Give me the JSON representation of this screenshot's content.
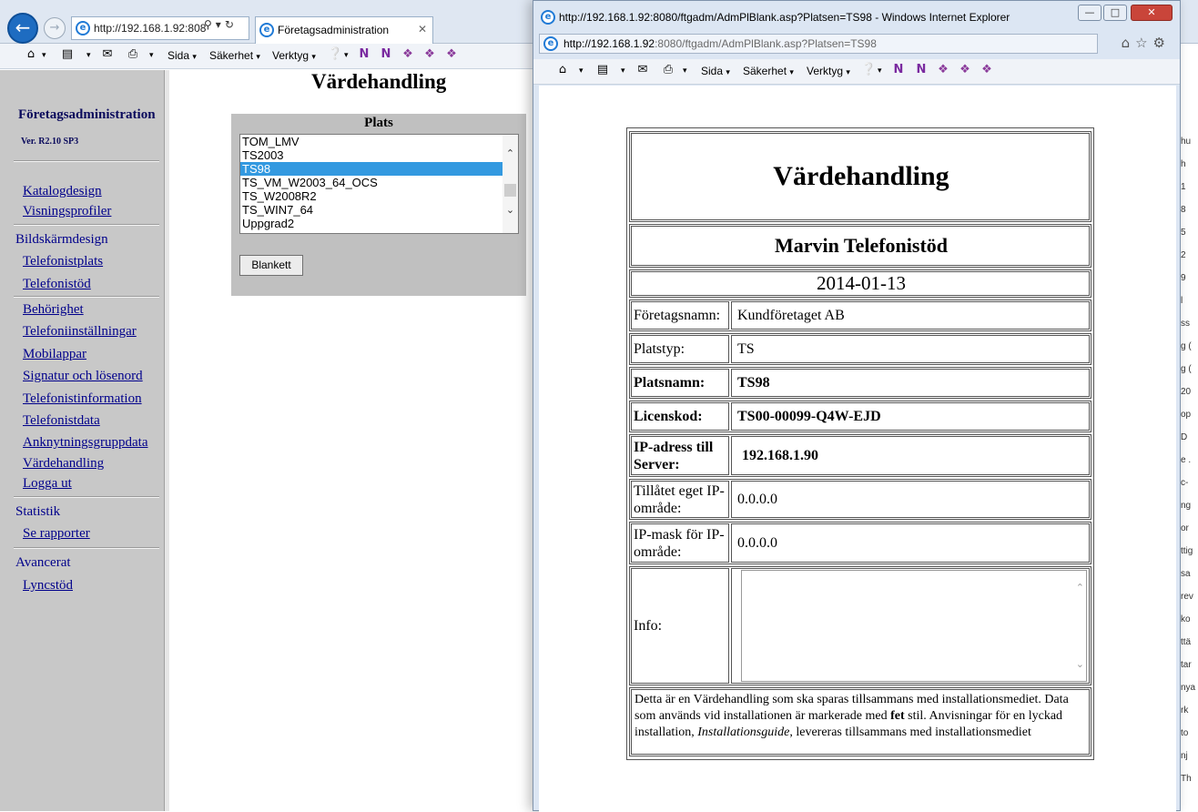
{
  "background_browser": {
    "address": "http://192.168.1.92:808",
    "tab_title": "Företagsadministration",
    "commands": {
      "page": "Sida",
      "security": "Säkerhet",
      "tools": "Verktyg"
    }
  },
  "sidebar": {
    "title": "Företagsadministration",
    "version": "Ver. R2.10 SP3",
    "links_top": [
      "Katalogdesign",
      "Visningsprofiler"
    ],
    "group_screen": "Bildskärmdesign",
    "links_screen": [
      "Telefonistplats",
      "Telefonistöd"
    ],
    "links_mid": [
      "Behörighet",
      "Telefoniinställningar",
      "Mobilappar",
      "Signatur och lösenord",
      "Telefonistinformation",
      "Telefonistdata",
      "Anknytningsgruppdata",
      "Värdehandling",
      "Logga ut"
    ],
    "group_stats": "Statistik",
    "links_stats": [
      "Se rapporter"
    ],
    "group_advanced": "Avancerat",
    "links_advanced": [
      "Lyncstöd"
    ]
  },
  "main": {
    "heading": "Värdehandling",
    "plats_label": "Plats",
    "plats_options": [
      "TOM_LMV",
      "TS2003",
      "TS98",
      "TS_VM_W2003_64_OCS",
      "TS_W2008R2",
      "TS_WIN7_64",
      "Uppgrad2"
    ],
    "selected_option": "TS98",
    "blankett_button": "Blankett"
  },
  "popup": {
    "title": "http://192.168.1.92:8080/ftgadm/AdmPlBlank.asp?Platsen=TS98 - Windows Internet Explorer",
    "address_host": "http://192.168.1.92",
    "address_rest": ":8080/ftgadm/AdmPlBlank.asp?Platsen=TS98",
    "commands": {
      "page": "Sida",
      "security": "Säkerhet",
      "tools": "Verktyg"
    },
    "document": {
      "title": "Värdehandling",
      "subtitle": "Marvin Telefonistöd",
      "date": "2014-01-13",
      "company_label": "Företagsnamn:",
      "company_value": "Kundföretaget AB",
      "platstyp_label": "Platstyp:",
      "platstyp_value": "TS",
      "platsnamn_label": "Platsnamn:",
      "platsnamn_value": "TS98",
      "licenskod_label": "Licenskod:",
      "licenskod_value": "TS00-00099-Q4W-EJD",
      "ip_label": "IP-adress till Server:",
      "ip_value": "192.168.1.90",
      "allowed_label": "Tillåtet eget IP-område:",
      "allowed_value": "0.0.0.0",
      "mask_label": "IP-mask för IP-område:",
      "mask_value": "0.0.0.0",
      "info_label": "Info:",
      "note_part1": "Detta är en Värdehandling som ska sparas tillsammans med installationsmediet. Data som används vid installationen är markerade med ",
      "note_bold": "fet",
      "note_part2": " stil. Anvisningar för en lyckad installation, ",
      "note_italic": "Installationsguide",
      "note_part3": ", levereras tillsammans med installationsmediet"
    }
  },
  "back_strip_chars": [
    "hu",
    "h",
    "1",
    "8",
    "5",
    "2",
    "9",
    "l",
    "ss",
    "g (",
    "g (",
    "20",
    "op",
    "D",
    "e .",
    "c-",
    "ng",
    "or",
    "ttig",
    "sa",
    "rev",
    "ko",
    "ttä",
    "tar",
    "nya",
    "rk",
    "to",
    "nj",
    "Th"
  ]
}
